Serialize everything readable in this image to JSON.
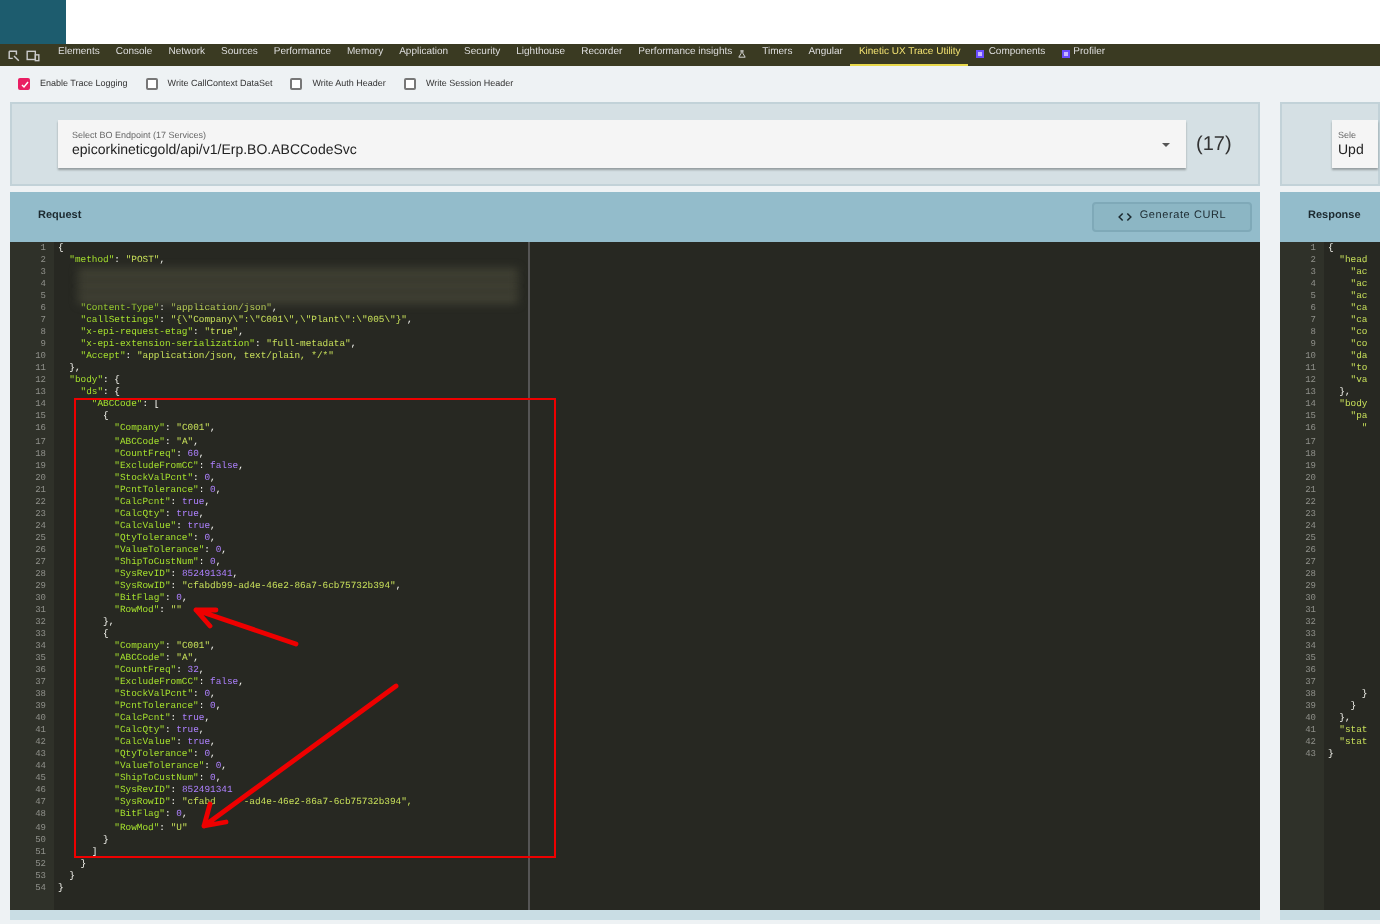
{
  "devtools_tabs": [
    {
      "label": "Elements",
      "selected": false,
      "kind": "plain"
    },
    {
      "label": "Console",
      "selected": false,
      "kind": "plain"
    },
    {
      "label": "Network",
      "selected": false,
      "kind": "plain"
    },
    {
      "label": "Sources",
      "selected": false,
      "kind": "plain"
    },
    {
      "label": "Performance",
      "selected": false,
      "kind": "plain"
    },
    {
      "label": "Memory",
      "selected": false,
      "kind": "plain"
    },
    {
      "label": "Application",
      "selected": false,
      "kind": "plain"
    },
    {
      "label": "Security",
      "selected": false,
      "kind": "plain"
    },
    {
      "label": "Lighthouse",
      "selected": false,
      "kind": "plain"
    },
    {
      "label": "Recorder",
      "selected": false,
      "kind": "plain"
    },
    {
      "label": "Performance insights",
      "selected": false,
      "kind": "experimental"
    },
    {
      "label": "Timers",
      "selected": false,
      "kind": "plain"
    },
    {
      "label": "Angular",
      "selected": false,
      "kind": "plain"
    },
    {
      "label": "Kinetic UX Trace Utility",
      "selected": true,
      "kind": "plain"
    },
    {
      "label": "Components",
      "selected": false,
      "kind": "extension"
    },
    {
      "label": "Profiler",
      "selected": false,
      "kind": "extension"
    }
  ],
  "options": [
    {
      "label": "Enable Trace Logging",
      "checked": true
    },
    {
      "label": "Write CallContext DataSet",
      "checked": false
    },
    {
      "label": "Write Auth Header",
      "checked": false
    },
    {
      "label": "Write Session Header",
      "checked": false
    }
  ],
  "endpoint": {
    "label": "Select BO Endpoint (17 Services)",
    "value": "epicorkineticgold/api/v1/Erp.BO.ABCCodeSvc",
    "count": "(17)"
  },
  "response_select": {
    "label": "Sele",
    "value": "Upd"
  },
  "request": {
    "title": "Request",
    "button": "Generate CURL",
    "lines": [
      {
        "number": "1",
        "kind": "code",
        "text": "{"
      },
      {
        "number": "2",
        "kind": "code",
        "text": "  \"method\": \"POST\","
      },
      {
        "number": "3",
        "kind": "redacted"
      },
      {
        "number": "4",
        "kind": "redacted"
      },
      {
        "number": "5",
        "kind": "redacted"
      },
      {
        "number": "6",
        "kind": "code",
        "text": "    \"Content-Type\": \"application/json\","
      },
      {
        "number": "7",
        "kind": "code",
        "text": "    \"callSettings\": \"{\\\"Company\\\":\\\"C001\\\",\\\"Plant\\\":\\\"005\\\"}\","
      },
      {
        "number": "8",
        "kind": "code",
        "text": "    \"x-epi-request-etag\": \"true\","
      },
      {
        "number": "9",
        "kind": "code",
        "text": "    \"x-epi-extension-serialization\": \"full-metadata\","
      },
      {
        "number": "10",
        "kind": "code",
        "text": "    \"Accept\": \"application/json, text/plain, */*\""
      },
      {
        "number": "11",
        "kind": "code",
        "text": "  },"
      },
      {
        "number": "12",
        "kind": "code",
        "text": "  \"body\": {"
      },
      {
        "number": "13",
        "kind": "code",
        "text": "    \"ds\": {"
      },
      {
        "number": "14",
        "kind": "code",
        "text": "      \"ABCCode\": ["
      },
      {
        "number": "15",
        "kind": "code",
        "text": "        {"
      },
      {
        "number": "16",
        "kind": "code",
        "text": "          \"Company\": \"C001\","
      },
      {
        "number": "17",
        "kind": "code",
        "text": "          \"ABCCode\": \"A\","
      },
      {
        "number": "18",
        "kind": "code",
        "text": "          \"CountFreq\": 60,"
      },
      {
        "number": "19",
        "kind": "code",
        "text": "          \"ExcludeFromCC\": false,"
      },
      {
        "number": "20",
        "kind": "code",
        "text": "          \"StockValPcnt\": 0,"
      },
      {
        "number": "21",
        "kind": "code",
        "text": "          \"PcntTolerance\": 0,"
      },
      {
        "number": "22",
        "kind": "code",
        "text": "          \"CalcPcnt\": true,"
      },
      {
        "number": "23",
        "kind": "code",
        "text": "          \"CalcQty\": true,"
      },
      {
        "number": "24",
        "kind": "code",
        "text": "          \"CalcValue\": true,"
      },
      {
        "number": "25",
        "kind": "code",
        "text": "          \"QtyTolerance\": 0,"
      },
      {
        "number": "26",
        "kind": "code",
        "text": "          \"ValueTolerance\": 0,"
      },
      {
        "number": "27",
        "kind": "code",
        "text": "          \"ShipToCustNum\": 0,"
      },
      {
        "number": "28",
        "kind": "code",
        "text": "          \"SysRevID\": 852491341,"
      },
      {
        "number": "29",
        "kind": "code",
        "text": "          \"SysRowID\": \"cfabdb99-ad4e-46e2-86a7-6cb75732b394\","
      },
      {
        "number": "30",
        "kind": "code",
        "text": "          \"BitFlag\": 0,"
      },
      {
        "number": "31",
        "kind": "code",
        "text": "          \"RowMod\": \"\""
      },
      {
        "number": "32",
        "kind": "code",
        "text": "        },"
      },
      {
        "number": "33",
        "kind": "code",
        "text": "        {"
      },
      {
        "number": "34",
        "kind": "code",
        "text": "          \"Company\": \"C001\","
      },
      {
        "number": "35",
        "kind": "code",
        "text": "          \"ABCCode\": \"A\","
      },
      {
        "number": "36",
        "kind": "code",
        "text": "          \"CountFreq\": 32,"
      },
      {
        "number": "37",
        "kind": "code",
        "text": "          \"ExcludeFromCC\": false,"
      },
      {
        "number": "38",
        "kind": "code",
        "text": "          \"StockValPcnt\": 0,"
      },
      {
        "number": "39",
        "kind": "code",
        "text": "          \"PcntTolerance\": 0,"
      },
      {
        "number": "40",
        "kind": "code",
        "text": "          \"CalcPcnt\": true,"
      },
      {
        "number": "41",
        "kind": "code",
        "text": "          \"CalcQty\": true,"
      },
      {
        "number": "42",
        "kind": "code",
        "text": "          \"CalcValue\": true,"
      },
      {
        "number": "43",
        "kind": "code",
        "text": "          \"QtyTolerance\": 0,"
      },
      {
        "number": "44",
        "kind": "code",
        "text": "          \"ValueTolerance\": 0,"
      },
      {
        "number": "45",
        "kind": "code",
        "text": "          \"ShipToCustNum\": 0,"
      },
      {
        "number": "46",
        "kind": "code",
        "text": "          \"SysRevID\": 852491341"
      },
      {
        "number": "47",
        "kind": "split",
        "text": "          \"SysRowID\": \"cfabd",
        "rest": "-ad4e-46e2-86a7-6cb75732b394\","
      },
      {
        "number": "48",
        "kind": "code",
        "text": "          \"BitFlag\": 0,"
      },
      {
        "number": "49",
        "kind": "code",
        "text": "          \"RowMod\": \"U\""
      },
      {
        "number": "50",
        "kind": "code",
        "text": "        }"
      },
      {
        "number": "51",
        "kind": "code",
        "text": "      ]"
      },
      {
        "number": "52",
        "kind": "code",
        "text": "    }"
      },
      {
        "number": "53",
        "kind": "code",
        "text": "  }"
      },
      {
        "number": "54",
        "kind": "code",
        "text": "}"
      }
    ]
  },
  "response": {
    "title": "Response",
    "lines": [
      {
        "number": "1",
        "kind": "code",
        "text": "{"
      },
      {
        "number": "2",
        "kind": "code",
        "text": "  \"head"
      },
      {
        "number": "3",
        "kind": "code",
        "text": "    \"ac"
      },
      {
        "number": "4",
        "kind": "code",
        "text": "    \"ac"
      },
      {
        "number": "5",
        "kind": "code",
        "text": "    \"ac"
      },
      {
        "number": "6",
        "kind": "code",
        "text": "    \"ca"
      },
      {
        "number": "7",
        "kind": "code",
        "text": "    \"ca"
      },
      {
        "number": "8",
        "kind": "code",
        "text": "    \"co"
      },
      {
        "number": "9",
        "kind": "code",
        "text": "    \"co"
      },
      {
        "number": "10",
        "kind": "code",
        "text": "    \"da"
      },
      {
        "number": "11",
        "kind": "code",
        "text": "    \"to"
      },
      {
        "number": "12",
        "kind": "code",
        "text": "    \"va"
      },
      {
        "number": "13",
        "kind": "code",
        "text": "  },"
      },
      {
        "number": "14",
        "kind": "code",
        "text": "  \"body"
      },
      {
        "number": "15",
        "kind": "code",
        "text": "    \"pa"
      },
      {
        "number": "16",
        "kind": "code",
        "text": "      \""
      },
      {
        "number": "17",
        "kind": "blank"
      },
      {
        "number": "18",
        "kind": "blank"
      },
      {
        "number": "19",
        "kind": "blank"
      },
      {
        "number": "20",
        "kind": "blank"
      },
      {
        "number": "21",
        "kind": "blank"
      },
      {
        "number": "22",
        "kind": "blank"
      },
      {
        "number": "23",
        "kind": "blank"
      },
      {
        "number": "24",
        "kind": "blank"
      },
      {
        "number": "25",
        "kind": "blank"
      },
      {
        "number": "26",
        "kind": "blank"
      },
      {
        "number": "27",
        "kind": "blank"
      },
      {
        "number": "28",
        "kind": "blank"
      },
      {
        "number": "29",
        "kind": "blank"
      },
      {
        "number": "30",
        "kind": "blank"
      },
      {
        "number": "31",
        "kind": "blank"
      },
      {
        "number": "32",
        "kind": "blank"
      },
      {
        "number": "33",
        "kind": "blank"
      },
      {
        "number": "34",
        "kind": "blank"
      },
      {
        "number": "35",
        "kind": "blank"
      },
      {
        "number": "36",
        "kind": "blank"
      },
      {
        "number": "37",
        "kind": "blank"
      },
      {
        "number": "38",
        "kind": "code",
        "text": "      }"
      },
      {
        "number": "39",
        "kind": "code",
        "text": "    }"
      },
      {
        "number": "40",
        "kind": "code",
        "text": "  },"
      },
      {
        "number": "41",
        "kind": "code",
        "text": "  \"stat"
      },
      {
        "number": "42",
        "kind": "code",
        "text": "  \"stat"
      },
      {
        "number": "43",
        "kind": "code",
        "text": "}"
      }
    ]
  }
}
